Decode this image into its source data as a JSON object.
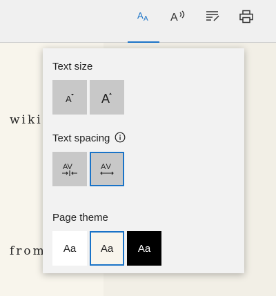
{
  "toolbar": {
    "buttons": [
      {
        "name": "text-options-icon",
        "active": true
      },
      {
        "name": "read-aloud-icon",
        "active": false
      },
      {
        "name": "grammar-tools-icon",
        "active": false
      },
      {
        "name": "print-icon",
        "active": false
      }
    ],
    "accent_color": "#1a73c7"
  },
  "page": {
    "line1": "wiki",
    "line2": "from"
  },
  "panel": {
    "text_size": {
      "title": "Text size",
      "options": [
        {
          "icon": "decrease-text-size-icon"
        },
        {
          "icon": "increase-text-size-icon"
        }
      ]
    },
    "text_spacing": {
      "title": "Text spacing",
      "info_icon": "info-icon",
      "options": [
        {
          "icon": "narrow-spacing-icon",
          "selected": false
        },
        {
          "icon": "wide-spacing-icon",
          "selected": true
        }
      ]
    },
    "page_theme": {
      "title": "Page theme",
      "options": [
        {
          "label": "Aa",
          "bg": "#ffffff",
          "fg": "#1e1e1e",
          "selected": false
        },
        {
          "label": "Aa",
          "bg": "#f8f5ec",
          "fg": "#1e1e1e",
          "selected": true
        },
        {
          "label": "Aa",
          "bg": "#000000",
          "fg": "#ffffff",
          "selected": false
        }
      ]
    }
  }
}
